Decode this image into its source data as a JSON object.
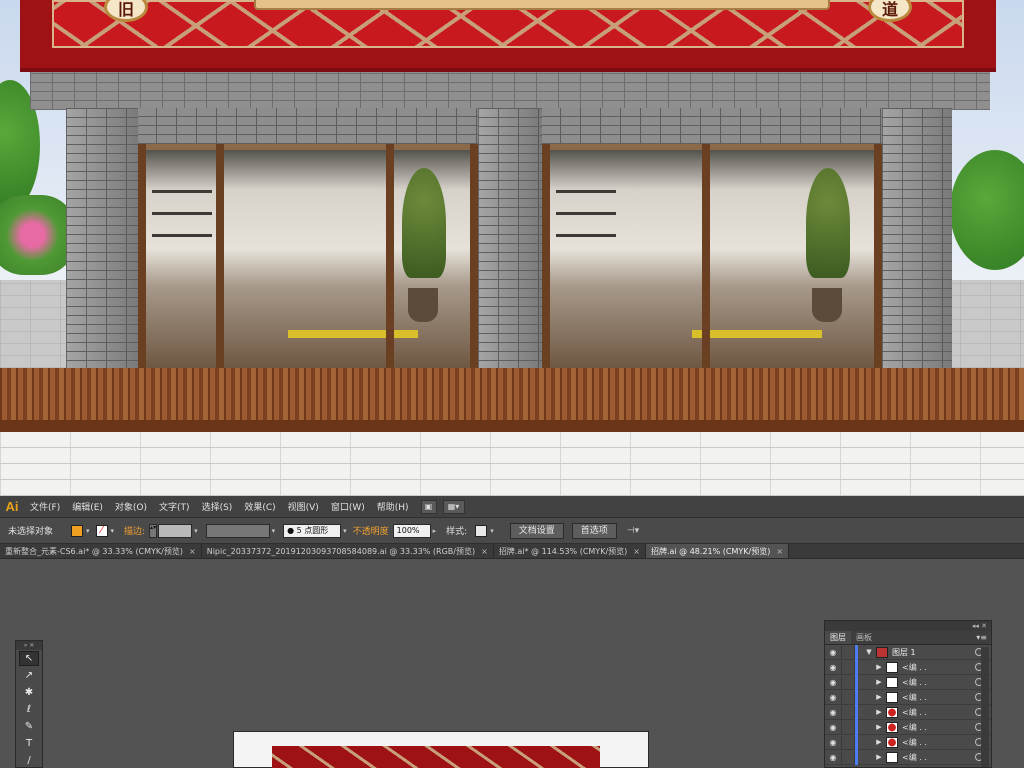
{
  "scene": {
    "sign_chars": [
      "旧",
      "道"
    ]
  },
  "app": {
    "logo": "Ai"
  },
  "menubar": {
    "items": [
      "文件(F)",
      "编辑(E)",
      "对象(O)",
      "文字(T)",
      "选择(S)",
      "效果(C)",
      "视图(V)",
      "窗口(W)",
      "帮助(H)"
    ]
  },
  "controlbar": {
    "selection": "未选择对象",
    "fill_color": "#f0a020",
    "stroke_color": "#ffffff",
    "stroke_label": "描边:",
    "brush_value": "5 点圆形",
    "opacity_label": "不透明度",
    "opacity_value": "100%",
    "style_label": "样式:",
    "doc_setup": "文档设置",
    "preferences": "首选项"
  },
  "tabs": [
    {
      "label": "重新整合_元素-CS6.ai* @ 33.33% (CMYK/预览)",
      "close": "×"
    },
    {
      "label": "Nipic_20337372_20191203093708584089.ai @ 33.33% (RGB/预览)",
      "close": "×"
    },
    {
      "label": "招牌.ai* @ 114.53% (CMYK/预览)",
      "close": "×"
    },
    {
      "label": "招牌.ai @ 48.21% (CMYK/预览)",
      "close": "×"
    }
  ],
  "tools": {
    "header": "»  ✕",
    "items": [
      {
        "name": "selection-tool",
        "glyph": "↖"
      },
      {
        "name": "direct-selection-tool",
        "glyph": "↗"
      },
      {
        "name": "magic-wand-tool",
        "glyph": "✱"
      },
      {
        "name": "lasso-tool",
        "glyph": "ℓ"
      },
      {
        "name": "pen-tool",
        "glyph": "✎"
      },
      {
        "name": "type-tool",
        "glyph": "T"
      },
      {
        "name": "line-tool",
        "glyph": "/"
      }
    ]
  },
  "layers_panel": {
    "top": "◂◂ ✕",
    "tabs": [
      "图层",
      "画板"
    ],
    "menu": "▾≡",
    "top_layer": "图层 1",
    "rows": [
      {
        "name": "<编 . .",
        "thumb": "white"
      },
      {
        "name": "<编 . .",
        "thumb": "white"
      },
      {
        "name": "<编 . .",
        "thumb": "white"
      },
      {
        "name": "<编 . .",
        "thumb": "red"
      },
      {
        "name": "<编 . .",
        "thumb": "red"
      },
      {
        "name": "<编 . .",
        "thumb": "red"
      },
      {
        "name": "<编 . .",
        "thumb": "white"
      }
    ]
  }
}
